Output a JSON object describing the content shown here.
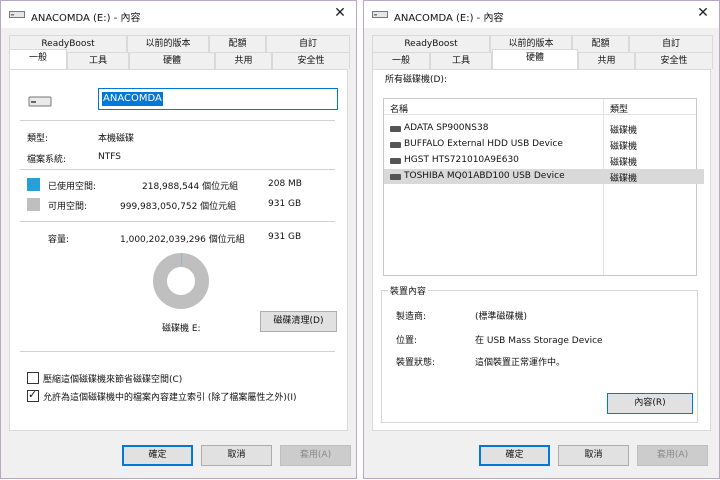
{
  "left": {
    "title": "ANACOMDA (E:) - 內容",
    "tabs_row1": [
      "ReadyBoost",
      "以前的版本",
      "配額",
      "自訂"
    ],
    "tabs_row2": [
      "一般",
      "工具",
      "硬體",
      "共用",
      "安全性"
    ],
    "name_value": "ANACOMDA",
    "type_label": "類型:",
    "type_value": "本機磁碟",
    "fs_label": "檔案系統:",
    "fs_value": "NTFS",
    "used": {
      "label": "已使用空間:",
      "bytes": "218,988,544 個位元組",
      "size": "208 MB",
      "color": "#26a0da"
    },
    "free": {
      "label": "可用空間:",
      "bytes": "999,983,050,752 個位元組",
      "size": "931 GB",
      "color": "#bfbfbf"
    },
    "capacity": {
      "label": "容量:",
      "bytes": "1,000,202,039,296 個位元組",
      "size": "931 GB"
    },
    "disk_label": "磁碟機 E:",
    "cleanup_button": "磁碟清理(D)",
    "compress_checkbox": {
      "label": "壓縮這個磁碟機來節省磁碟空間(C)",
      "checked": false
    },
    "index_checkbox": {
      "label": "允許為這個磁碟機中的檔案內容建立索引 (除了檔案屬性之外)(I)",
      "checked": true
    },
    "ok": "確定",
    "cancel": "取消",
    "apply": "套用(A)"
  },
  "right": {
    "title": "ANACOMDA (E:) - 內容",
    "tabs_row1": [
      "ReadyBoost",
      "以前的版本",
      "配額",
      "自訂"
    ],
    "tabs_row2": [
      "一般",
      "工具",
      "硬體",
      "共用",
      "安全性"
    ],
    "all_drives_label": "所有磁碟機(D):",
    "columns": [
      "名稱",
      "類型"
    ],
    "devices": [
      {
        "name": "ADATA SP900NS38",
        "type": "磁碟機"
      },
      {
        "name": "BUFFALO External HDD USB Device",
        "type": "磁碟機"
      },
      {
        "name": "HGST HTS721010A9E630",
        "type": "磁碟機"
      },
      {
        "name": "TOSHIBA MQ01ABD100 USB Device",
        "type": "磁碟機"
      }
    ],
    "group_title": "裝置內容",
    "manufacturer_label": "製造商:",
    "manufacturer_value": "(標準磁碟機)",
    "location_label": "位置:",
    "location_value": "在 USB Mass Storage Device",
    "status_label": "裝置狀態:",
    "status_value": "這個裝置正常運作中。",
    "properties_button": "內容(R)",
    "ok": "確定",
    "cancel": "取消",
    "apply": "套用(A)"
  }
}
